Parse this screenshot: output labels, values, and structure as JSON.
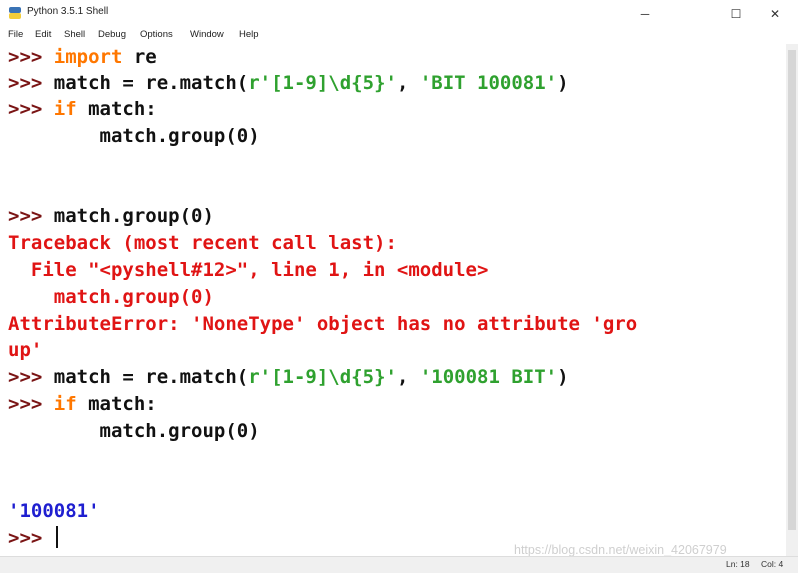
{
  "window": {
    "title": "Python 3.5.1 Shell",
    "minimize_symbol": "─",
    "maximize_symbol": "☐",
    "close_symbol": "✕",
    "app_icon": "python-icon"
  },
  "menu": {
    "file": "File",
    "edit": "Edit",
    "shell": "Shell",
    "debug": "Debug",
    "options": "Options",
    "window": "Window",
    "help": "Help"
  },
  "shell": {
    "l1": {
      "prompt": ">>> ",
      "kw": "import",
      "rest": " re"
    },
    "l2": {
      "prompt": ">>> ",
      "a": "match = re.match(",
      "s1": "r'[1-9]\\d{5}'",
      "b": ", ",
      "s2": "'BIT 100081'",
      "c": ")"
    },
    "l3": {
      "prompt": ">>> ",
      "kw": "if",
      "rest": " match:"
    },
    "l4": {
      "text": "        match.group(0)"
    },
    "l5": {
      "prompt": ">>> ",
      "rest": "match.group(0)"
    },
    "l6": {
      "text": "Traceback (most recent call last):"
    },
    "l7": {
      "text": "  File \"<pyshell#12>\", line 1, in <module>"
    },
    "l8": {
      "text": "    match.group(0)"
    },
    "l9": {
      "text": "AttributeError: 'NoneType' object has no attribute 'gro"
    },
    "l10": {
      "text": "up'"
    },
    "l11": {
      "prompt": ">>> ",
      "a": "match = re.match(",
      "s1": "r'[1-9]\\d{5}'",
      "b": ", ",
      "s2": "'100081 BIT'",
      "c": ")"
    },
    "l12": {
      "prompt": ">>> ",
      "kw": "if",
      "rest": " match:"
    },
    "l13": {
      "text": "        match.group(0)"
    },
    "l14": {
      "text": "'100081'"
    },
    "l15": {
      "prompt": ">>> "
    }
  },
  "status": {
    "ln": "Ln: 18",
    "col": "Col: 4"
  },
  "watermark": "https://blog.csdn.net/weixin_42067979",
  "colors": {
    "prompt": "#7a1414",
    "keyword": "#ff7700",
    "string": "#2fa12f",
    "error": "#e01414",
    "output": "#1f1fd0"
  }
}
